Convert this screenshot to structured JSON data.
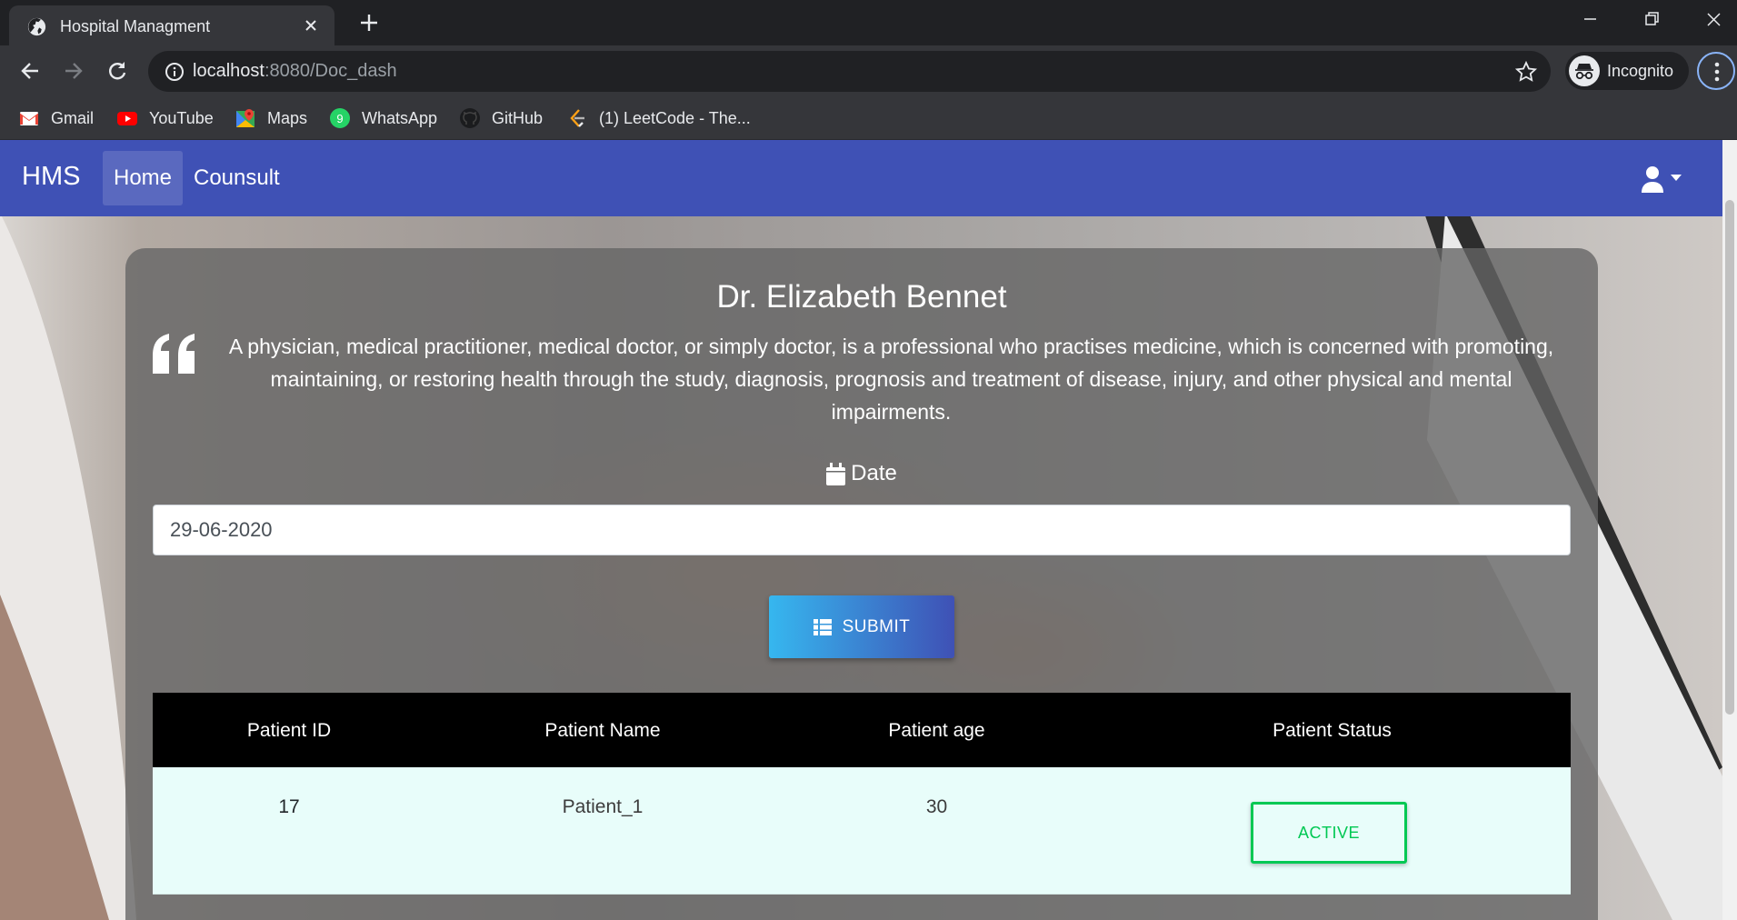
{
  "browser": {
    "tab_title": "Hospital Managment",
    "url_host": "localhost",
    "url_rest": ":8080/Doc_dash",
    "profile_label": "Incognito",
    "bookmarks": [
      {
        "label": "Gmail",
        "icon": "gmail-icon"
      },
      {
        "label": "YouTube",
        "icon": "youtube-icon"
      },
      {
        "label": "Maps",
        "icon": "maps-icon"
      },
      {
        "label": "WhatsApp",
        "icon": "whatsapp-icon"
      },
      {
        "label": "GitHub",
        "icon": "github-icon"
      },
      {
        "label": "(1) LeetCode - The...",
        "icon": "leetcode-icon"
      }
    ],
    "whatsapp_badge": "9"
  },
  "navbar": {
    "brand": "HMS",
    "links": [
      {
        "label": "Home",
        "active": true
      },
      {
        "label": "Counsult",
        "active": false
      }
    ],
    "accent_color": "#3f51b5"
  },
  "doctor": {
    "name": "Dr. Elizabeth Bennet",
    "description": "A physician, medical practitioner, medical doctor, or simply doctor, is a professional who practises medicine, which is concerned with promoting, maintaining, or restoring health through the study, diagnosis, prognosis and treatment of disease, injury, and other physical and mental impairments."
  },
  "form": {
    "date_label": "Date",
    "date_value": "29-06-2020",
    "submit_label": "SUBMIT"
  },
  "table": {
    "headers": [
      "Patient ID",
      "Patient Name",
      "Patient age",
      "Patient Status"
    ],
    "rows": [
      {
        "id": "17",
        "name": "Patient_1",
        "age": "30",
        "status": "ACTIVE"
      }
    ],
    "status_color": "#00c853"
  }
}
